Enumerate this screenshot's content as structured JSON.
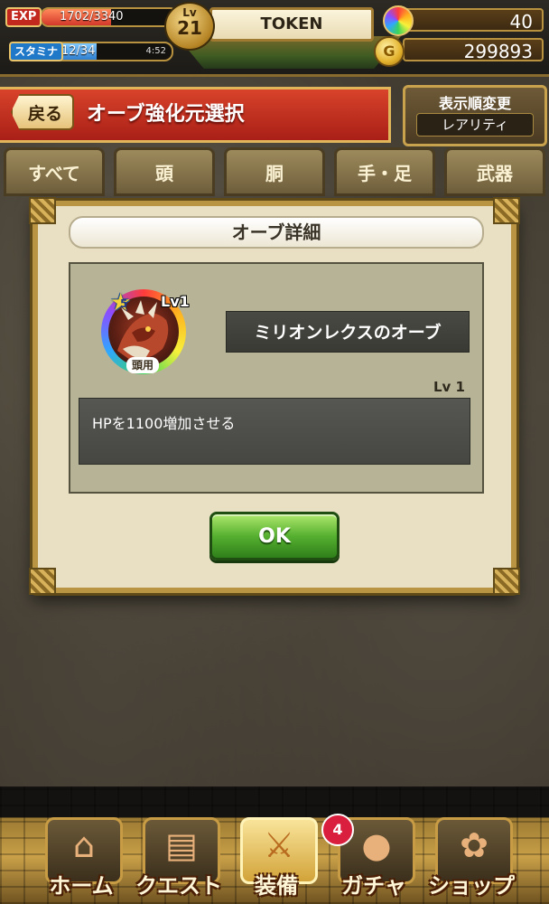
{
  "status": {
    "exp_label": "EXP",
    "exp_value": "1702/3340",
    "exp_fraction": 0.51,
    "stamina_label": "スタミナ",
    "stamina_value": "12/34",
    "stamina_fraction": 0.35,
    "stamina_timer": "4:52",
    "level_tag": "Lv",
    "level": "21",
    "player_name": "TOKEN",
    "stones": "40",
    "coins": "299893",
    "coin_symbol": "G"
  },
  "header": {
    "back_label": "戻る",
    "title": "オーブ強化元選択",
    "sort_title": "表示順変更",
    "sort_value": "レアリティ"
  },
  "tabs": [
    {
      "label": "すべて",
      "active": true
    },
    {
      "label": "頭",
      "active": false
    },
    {
      "label": "胴",
      "active": false
    },
    {
      "label": "手・足",
      "active": false
    },
    {
      "label": "武器",
      "active": false
    }
  ],
  "modal": {
    "title": "オーブ詳細",
    "orb": {
      "rarity": "5",
      "level": "Lv1",
      "slot": "頭用",
      "name": "ミリオンレクスのオーブ"
    },
    "effect_level": "Lv 1",
    "effect_text": "HPを1100増加させる",
    "ok_label": "OK"
  },
  "nav": {
    "items": [
      {
        "label": "ホーム",
        "icon": "home-icon",
        "glyph": "⌂",
        "active": false
      },
      {
        "label": "クエスト",
        "icon": "quest-icon",
        "glyph": "▤",
        "active": false
      },
      {
        "label": "装備",
        "icon": "equipment-icon",
        "glyph": "⚔",
        "active": true
      },
      {
        "label": "ガチャ",
        "icon": "gacha-icon",
        "glyph": "●",
        "active": false
      },
      {
        "label": "ショップ",
        "icon": "shop-icon",
        "glyph": "✿",
        "active": false
      }
    ],
    "gacha_badge": "4"
  },
  "colors": {
    "header_red": "#c4321f",
    "ok_green": "#56b030",
    "badge_red": "#d91e3e",
    "gold_border": "#b89443"
  }
}
